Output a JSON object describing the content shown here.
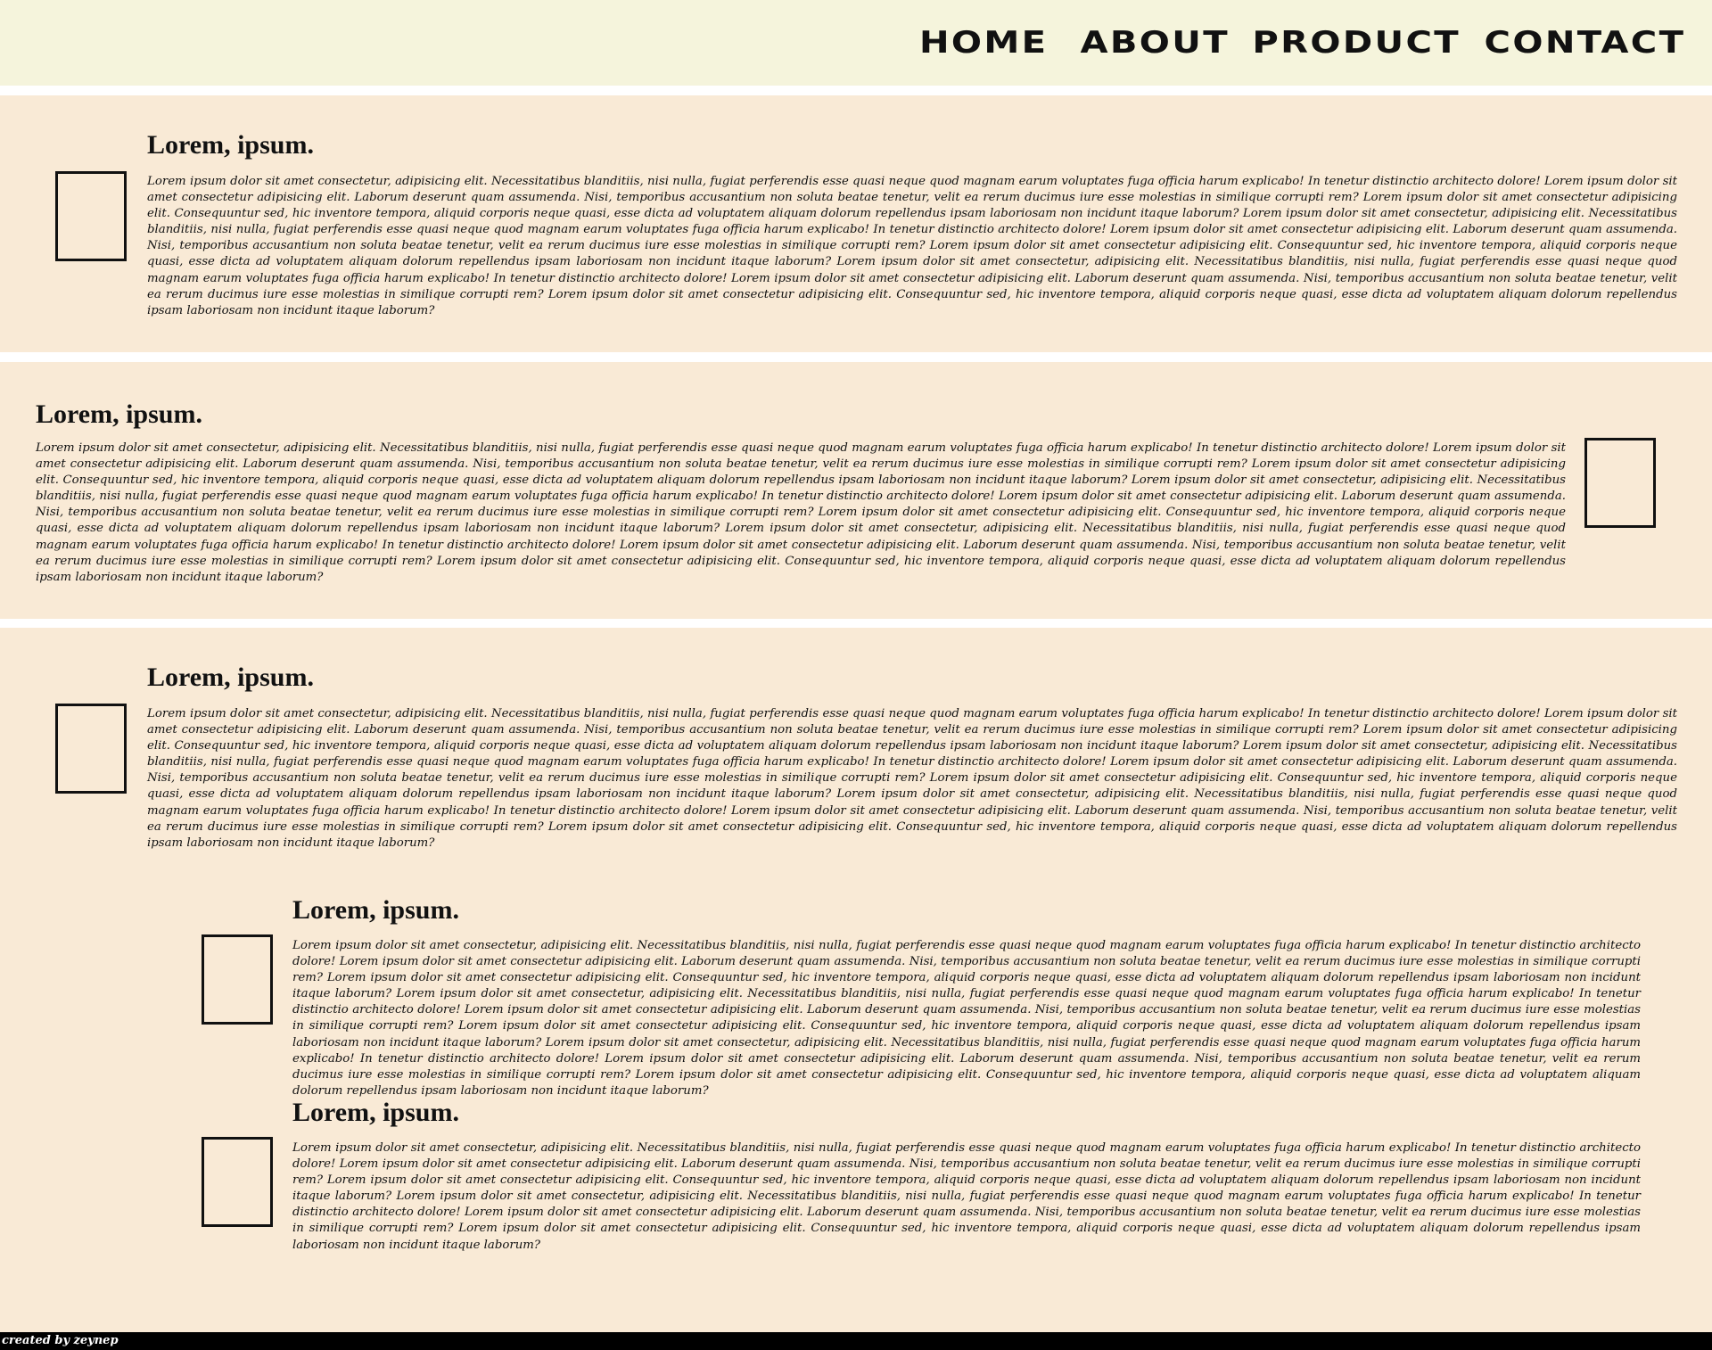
{
  "nav": {
    "items": [
      {
        "label": "HOME"
      },
      {
        "label": "ABOUT"
      },
      {
        "label": "PRODUCT"
      },
      {
        "label": "CONTACT"
      }
    ]
  },
  "sections": [
    {
      "title": "Lorem, ipsum.",
      "text": "Lorem ipsum dolor sit amet consectetur, adipisicing elit. Necessitatibus blanditiis, nisi nulla, fugiat perferendis esse quasi neque quod magnam earum voluptates fuga officia harum explicabo! In tenetur distinctio architecto dolore! Lorem ipsum dolor sit amet consectetur adipisicing elit. Laborum deserunt quam assumenda. Nisi, temporibus accusantium non soluta beatae tenetur, velit ea rerum ducimus iure esse molestias in similique corrupti rem? Lorem ipsum dolor sit amet consectetur adipisicing elit. Consequuntur sed, hic inventore tempora, aliquid corporis neque quasi, esse dicta ad voluptatem aliquam dolorum repellendus ipsam laboriosam non incidunt itaque laborum? Lorem ipsum dolor sit amet consectetur, adipisicing elit. Necessitatibus blanditiis, nisi nulla, fugiat perferendis esse quasi neque quod magnam earum voluptates fuga officia harum explicabo! In tenetur distinctio architecto dolore! Lorem ipsum dolor sit amet consectetur adipisicing elit. Laborum deserunt quam assumenda. Nisi, temporibus accusantium non soluta beatae tenetur, velit ea rerum ducimus iure esse molestias in similique corrupti rem? Lorem ipsum dolor sit amet consectetur adipisicing elit. Consequuntur sed, hic inventore tempora, aliquid corporis neque quasi, esse dicta ad voluptatem aliquam dolorum repellendus ipsam laboriosam non incidunt itaque laborum? Lorem ipsum dolor sit amet consectetur, adipisicing elit. Necessitatibus blanditiis, nisi nulla, fugiat perferendis esse quasi neque quod magnam earum voluptates fuga officia harum explicabo! In tenetur distinctio architecto dolore! Lorem ipsum dolor sit amet consectetur adipisicing elit. Laborum deserunt quam assumenda. Nisi, temporibus accusantium non soluta beatae tenetur, velit ea rerum ducimus iure esse molestias in similique corrupti rem? Lorem ipsum dolor sit amet consectetur adipisicing elit. Consequuntur sed, hic inventore tempora, aliquid corporis neque quasi, esse dicta ad voluptatem aliquam dolorum repellendus ipsam laboriosam non incidunt itaque laborum?"
    },
    {
      "title": "Lorem, ipsum.",
      "text": "Lorem ipsum dolor sit amet consectetur, adipisicing elit. Necessitatibus blanditiis, nisi nulla, fugiat perferendis esse quasi neque quod magnam earum voluptates fuga officia harum explicabo! In tenetur distinctio architecto dolore! Lorem ipsum dolor sit amet consectetur adipisicing elit. Laborum deserunt quam assumenda. Nisi, temporibus accusantium non soluta beatae tenetur, velit ea rerum ducimus iure esse molestias in similique corrupti rem? Lorem ipsum dolor sit amet consectetur adipisicing elit. Consequuntur sed, hic inventore tempora, aliquid corporis neque quasi, esse dicta ad voluptatem aliquam dolorum repellendus ipsam laboriosam non incidunt itaque laborum? Lorem ipsum dolor sit amet consectetur, adipisicing elit. Necessitatibus blanditiis, nisi nulla, fugiat perferendis esse quasi neque quod magnam earum voluptates fuga officia harum explicabo! In tenetur distinctio architecto dolore! Lorem ipsum dolor sit amet consectetur adipisicing elit. Laborum deserunt quam assumenda. Nisi, temporibus accusantium non soluta beatae tenetur, velit ea rerum ducimus iure esse molestias in similique corrupti rem? Lorem ipsum dolor sit amet consectetur adipisicing elit. Consequuntur sed, hic inventore tempora, aliquid corporis neque quasi, esse dicta ad voluptatem aliquam dolorum repellendus ipsam laboriosam non incidunt itaque laborum? Lorem ipsum dolor sit amet consectetur, adipisicing elit. Necessitatibus blanditiis, nisi nulla, fugiat perferendis esse quasi neque quod magnam earum voluptates fuga officia harum explicabo! In tenetur distinctio architecto dolore! Lorem ipsum dolor sit amet consectetur adipisicing elit. Laborum deserunt quam assumenda. Nisi, temporibus accusantium non soluta beatae tenetur, velit ea rerum ducimus iure esse molestias in similique corrupti rem? Lorem ipsum dolor sit amet consectetur adipisicing elit. Consequuntur sed, hic inventore tempora, aliquid corporis neque quasi, esse dicta ad voluptatem aliquam dolorum repellendus ipsam laboriosam non incidunt itaque laborum?"
    },
    {
      "title": "Lorem, ipsum.",
      "text": "Lorem ipsum dolor sit amet consectetur, adipisicing elit. Necessitatibus blanditiis, nisi nulla, fugiat perferendis esse quasi neque quod magnam earum voluptates fuga officia harum explicabo! In tenetur distinctio architecto dolore! Lorem ipsum dolor sit amet consectetur adipisicing elit. Laborum deserunt quam assumenda. Nisi, temporibus accusantium non soluta beatae tenetur, velit ea rerum ducimus iure esse molestias in similique corrupti rem? Lorem ipsum dolor sit amet consectetur adipisicing elit. Consequuntur sed, hic inventore tempora, aliquid corporis neque quasi, esse dicta ad voluptatem aliquam dolorum repellendus ipsam laboriosam non incidunt itaque laborum? Lorem ipsum dolor sit amet consectetur, adipisicing elit. Necessitatibus blanditiis, nisi nulla, fugiat perferendis esse quasi neque quod magnam earum voluptates fuga officia harum explicabo! In tenetur distinctio architecto dolore! Lorem ipsum dolor sit amet consectetur adipisicing elit. Laborum deserunt quam assumenda. Nisi, temporibus accusantium non soluta beatae tenetur, velit ea rerum ducimus iure esse molestias in similique corrupti rem? Lorem ipsum dolor sit amet consectetur adipisicing elit. Consequuntur sed, hic inventore tempora, aliquid corporis neque quasi, esse dicta ad voluptatem aliquam dolorum repellendus ipsam laboriosam non incidunt itaque laborum? Lorem ipsum dolor sit amet consectetur, adipisicing elit. Necessitatibus blanditiis, nisi nulla, fugiat perferendis esse quasi neque quod magnam earum voluptates fuga officia harum explicabo! In tenetur distinctio architecto dolore! Lorem ipsum dolor sit amet consectetur adipisicing elit. Laborum deserunt quam assumenda. Nisi, temporibus accusantium non soluta beatae tenetur, velit ea rerum ducimus iure esse molestias in similique corrupti rem? Lorem ipsum dolor sit amet consectetur adipisicing elit. Consequuntur sed, hic inventore tempora, aliquid corporis neque quasi, esse dicta ad voluptatem aliquam dolorum repellendus ipsam laboriosam non incidunt itaque laborum?"
    },
    {
      "title": "Lorem, ipsum.",
      "text": "Lorem ipsum dolor sit amet consectetur, adipisicing elit. Necessitatibus blanditiis, nisi nulla, fugiat perferendis esse quasi neque quod magnam earum voluptates fuga officia harum explicabo! In tenetur distinctio architecto dolore! Lorem ipsum dolor sit amet consectetur adipisicing elit. Laborum deserunt quam assumenda. Nisi, temporibus accusantium non soluta beatae tenetur, velit ea rerum ducimus iure esse molestias in similique corrupti rem? Lorem ipsum dolor sit amet consectetur adipisicing elit. Consequuntur sed, hic inventore tempora, aliquid corporis neque quasi, esse dicta ad voluptatem aliquam dolorum repellendus ipsam laboriosam non incidunt itaque laborum? Lorem ipsum dolor sit amet consectetur, adipisicing elit. Necessitatibus blanditiis, nisi nulla, fugiat perferendis esse quasi neque quod magnam earum voluptates fuga officia harum explicabo! In tenetur distinctio architecto dolore! Lorem ipsum dolor sit amet consectetur adipisicing elit. Laborum deserunt quam assumenda. Nisi, temporibus accusantium non soluta beatae tenetur, velit ea rerum ducimus iure esse molestias in similique corrupti rem? Lorem ipsum dolor sit amet consectetur adipisicing elit. Consequuntur sed, hic inventore tempora, aliquid corporis neque quasi, esse dicta ad voluptatem aliquam dolorum repellendus ipsam laboriosam non incidunt itaque laborum? Lorem ipsum dolor sit amet consectetur, adipisicing elit. Necessitatibus blanditiis, nisi nulla, fugiat perferendis esse quasi neque quod magnam earum voluptates fuga officia harum explicabo! In tenetur distinctio architecto dolore! Lorem ipsum dolor sit amet consectetur adipisicing elit. Laborum deserunt quam assumenda. Nisi, temporibus accusantium non soluta beatae tenetur, velit ea rerum ducimus iure esse molestias in similique corrupti rem? Lorem ipsum dolor sit amet consectetur adipisicing elit. Consequuntur sed, hic inventore tempora, aliquid corporis neque quasi, esse dicta ad voluptatem aliquam dolorum repellendus ipsam laboriosam non incidunt itaque laborum?"
    },
    {
      "title": "Lorem, ipsum.",
      "text": "Lorem ipsum dolor sit amet consectetur, adipisicing elit. Necessitatibus blanditiis, nisi nulla, fugiat perferendis esse quasi neque quod magnam earum voluptates fuga officia harum explicabo! In tenetur distinctio architecto dolore! Lorem ipsum dolor sit amet consectetur adipisicing elit. Laborum deserunt quam assumenda. Nisi, temporibus accusantium non soluta beatae tenetur, velit ea rerum ducimus iure esse molestias in similique corrupti rem? Lorem ipsum dolor sit amet consectetur adipisicing elit. Consequuntur sed, hic inventore tempora, aliquid corporis neque quasi, esse dicta ad voluptatem aliquam dolorum repellendus ipsam laboriosam non incidunt itaque laborum? Lorem ipsum dolor sit amet consectetur, adipisicing elit. Necessitatibus blanditiis, nisi nulla, fugiat perferendis esse quasi neque quod magnam earum voluptates fuga officia harum explicabo! In tenetur distinctio architecto dolore! Lorem ipsum dolor sit amet consectetur adipisicing elit. Laborum deserunt quam assumenda. Nisi, temporibus accusantium non soluta beatae tenetur, velit ea rerum ducimus iure esse molestias in similique corrupti rem? Lorem ipsum dolor sit amet consectetur adipisicing elit. Consequuntur sed, hic inventore tempora, aliquid corporis neque quasi, esse dicta ad voluptatem aliquam dolorum repellendus ipsam laboriosam non incidunt itaque laborum?"
    }
  ],
  "footer": {
    "text": "created by zeynep"
  },
  "colors": {
    "nav_bg": "#f5f4dc",
    "section_bg": "#f9ead6",
    "footer_bg": "#000000"
  }
}
